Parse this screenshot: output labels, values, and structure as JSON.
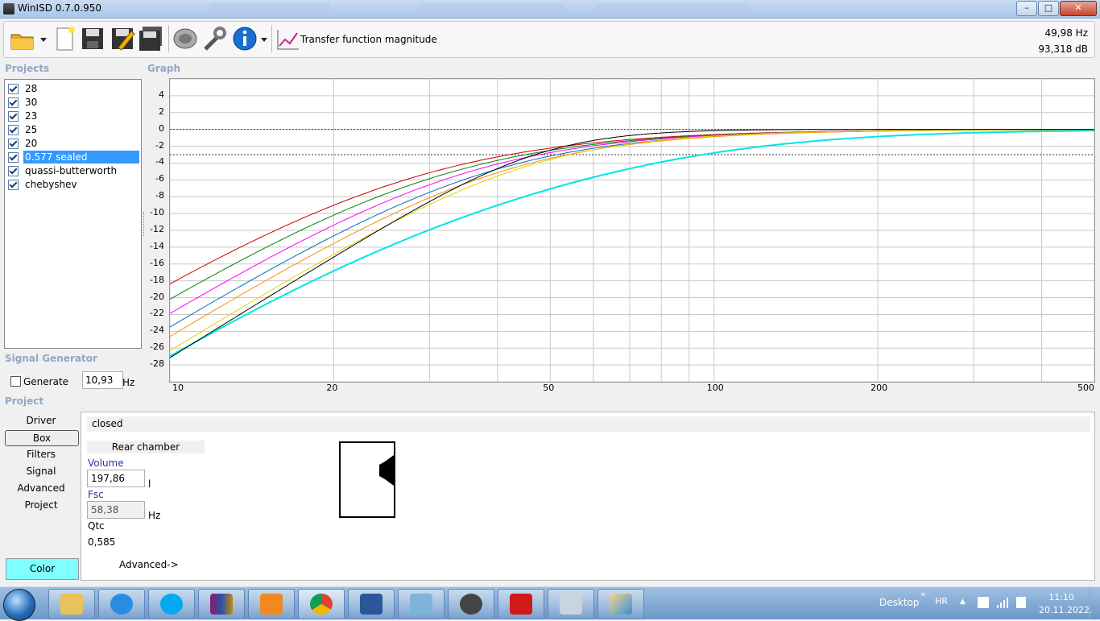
{
  "window": {
    "title": "WinISD 0.7.0.950"
  },
  "toolbar": {
    "function_label": "Transfer function magnitude",
    "freq_readout": "49,98 Hz",
    "db_readout": "93,318 dB"
  },
  "projects": {
    "label": "Projects",
    "items": [
      {
        "name": "28",
        "checked": true
      },
      {
        "name": "30",
        "checked": true
      },
      {
        "name": "23",
        "checked": true
      },
      {
        "name": "25",
        "checked": true
      },
      {
        "name": "20",
        "checked": true
      },
      {
        "name": "0.577 sealed",
        "checked": true,
        "selected": true
      },
      {
        "name": "quassi-butterworth",
        "checked": true
      },
      {
        "name": "chebyshev",
        "checked": true
      }
    ]
  },
  "graph": {
    "label": "Graph"
  },
  "chart_data": {
    "type": "line",
    "x_scale": "log",
    "xlim": [
      10,
      500
    ],
    "ylim": [
      -30,
      6
    ],
    "x_ticks": [
      "10",
      "20",
      "50",
      "100",
      "200",
      "500"
    ],
    "y_ticks": [
      "4",
      "2",
      "0",
      "-2",
      "-4",
      "-6",
      "-8",
      "-10",
      "-12",
      "-14",
      "-16",
      "-18",
      "-20",
      "-22",
      "-24",
      "-26",
      "-28"
    ],
    "grid": true,
    "reference_lines": [
      0,
      -3
    ],
    "series": [
      {
        "color": "#cc0000",
        "fc": 27.0,
        "q": 0.5
      },
      {
        "color": "#008800",
        "fc": 30.6,
        "q": 0.52
      },
      {
        "color": "#ff00ff",
        "fc": 34.2,
        "q": 0.54
      },
      {
        "color": "#0070c0",
        "fc": 37.8,
        "q": 0.55
      },
      {
        "color": "#ff8c00",
        "fc": 40.5,
        "q": 0.56
      },
      {
        "color": "#00e5e5",
        "fc": 45.0,
        "q": 0.4
      },
      {
        "color": "#e6d200",
        "fc": 45.0,
        "q": 0.6
      },
      {
        "color": "#000000",
        "fc": 47.7,
        "q": 0.72
      }
    ]
  },
  "signal_generator": {
    "label": "Signal Generator",
    "generate_label": "Generate",
    "value": "10,93",
    "unit": "Hz"
  },
  "project_panel": {
    "label": "Project",
    "nav": [
      "Driver",
      "Box",
      "Filters",
      "Signal",
      "Advanced",
      "Project"
    ],
    "color_button": "Color",
    "box_type": "closed",
    "rear_chamber": "Rear chamber",
    "volume_label": "Volume",
    "volume_value": "197,86",
    "volume_unit": "l",
    "fsc_label": "Fsc",
    "fsc_value": "58,38",
    "fsc_unit": "Hz",
    "qtc_label": "Qtc",
    "qtc_value": "0,585",
    "advanced_link": "Advanced->"
  },
  "taskbar": {
    "desktop_label": "Desktop",
    "lang": "HR",
    "time": "11:10",
    "date": "20.11.2022."
  }
}
